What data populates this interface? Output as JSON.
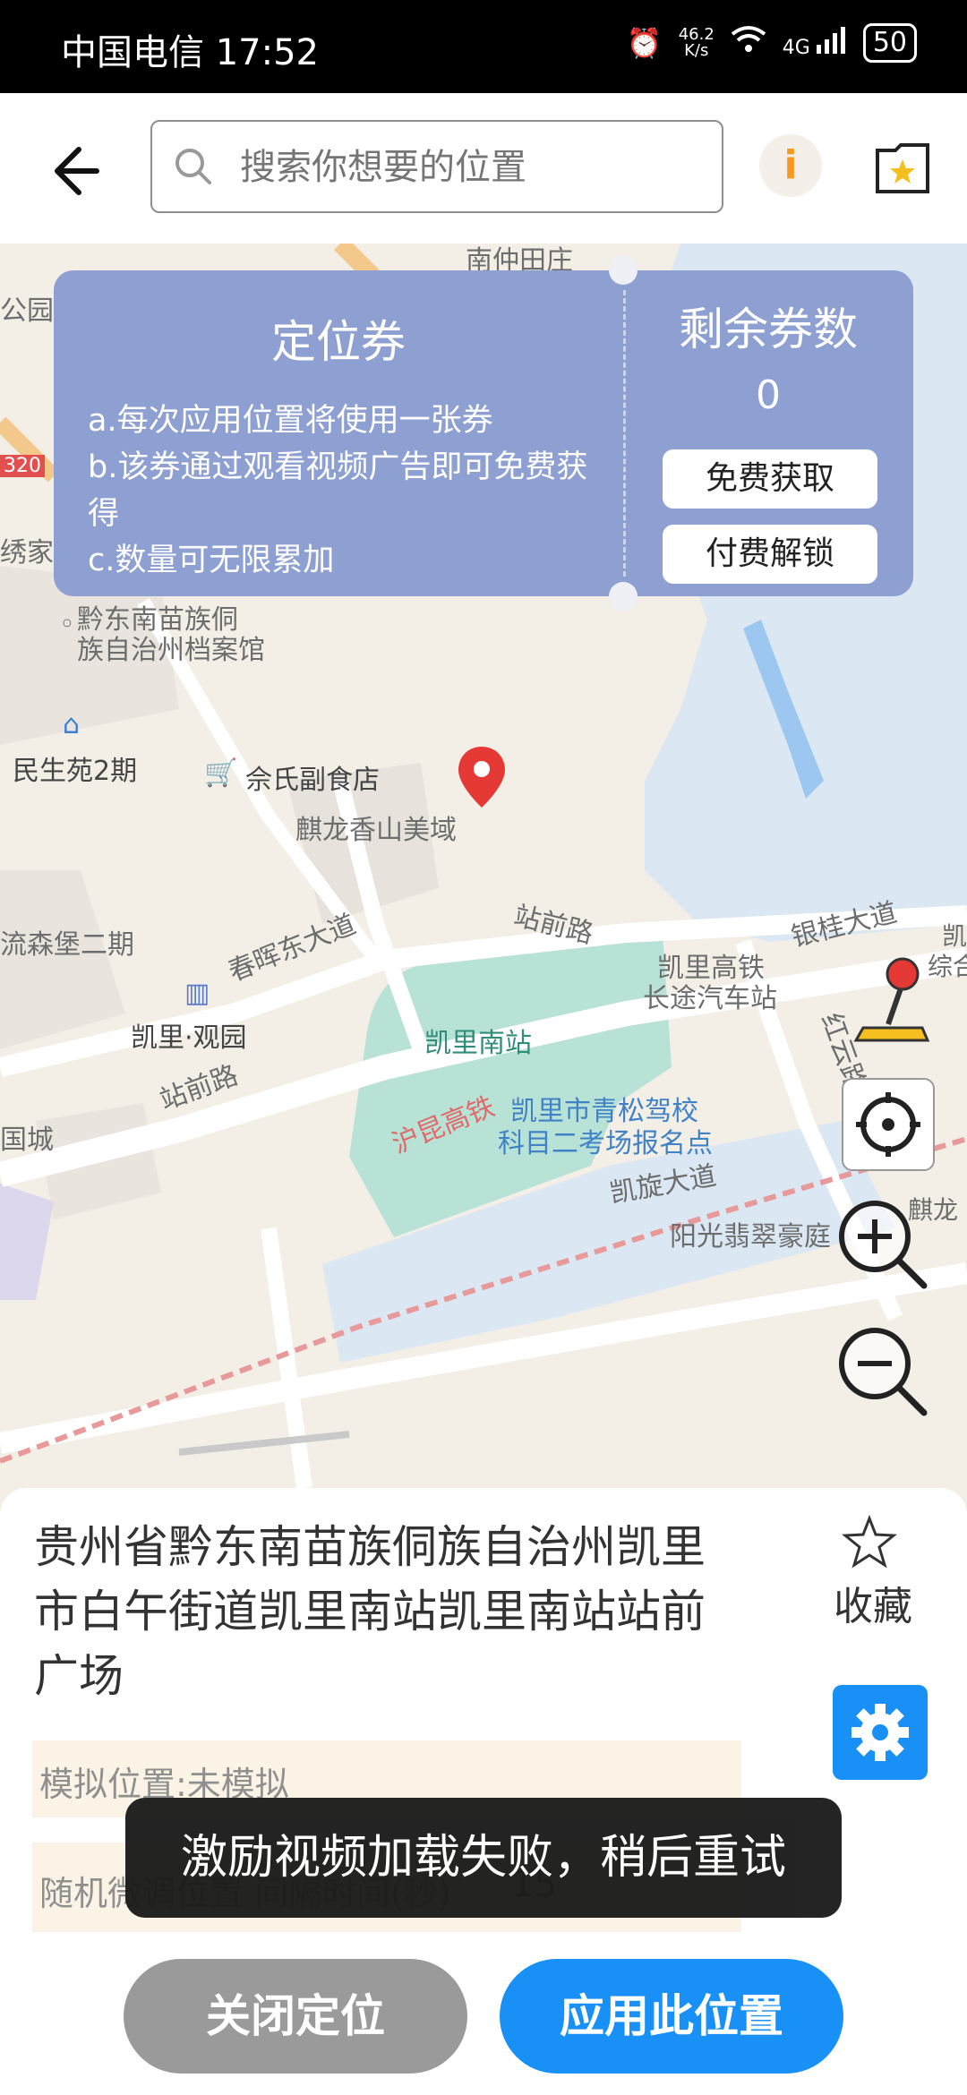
{
  "status_bar": {
    "carrier_time": "中国电信 17:52",
    "net_speed_top": "46.2",
    "net_speed_unit": "K/s",
    "network": "4G",
    "battery": "50"
  },
  "top_bar": {
    "search_placeholder": "搜索你想要的位置",
    "info_label": "i"
  },
  "coupon": {
    "title": "定位券",
    "rules": [
      "a.每次应用位置将使用一张券",
      "b.该券通过观看视频广告即可免费获得",
      "c.数量可无限累加"
    ],
    "remaining_label": "剩余券数",
    "remaining_count": "0",
    "free_button": "免费获取",
    "paid_button": "付费解锁"
  },
  "map": {
    "labels": {
      "archive": "黔东南苗族侗族自治州档案馆",
      "archive_line1": "黔东南苗族侗",
      "archive_line2": "族自治州档案馆",
      "minsheng": "民生苑2期",
      "yushi": "佘氏副食店",
      "qilong": "麒龙香山美域",
      "chunhui": "春晖东大道",
      "zhanqian_top": "站前路",
      "yingui": "银桂大道",
      "kaili_bus_1": "凯里高铁",
      "kaili_bus_2": "长途汽车站",
      "kaili_south": "凯里南站",
      "kaili_guanyuan": "凯里·观园",
      "zhanqian_bottom": "站前路",
      "hukun": "沪昆高铁",
      "driving_school_1": "凯里市青松驾校",
      "driving_school_2": "科目二考场报名点",
      "kaixuan": "凯旋大道",
      "hongyun": "红云路",
      "yangguang": "阳光翡翠豪庭",
      "liusen": "流森堡二期",
      "guocheng": "国城",
      "xiujia": "绣家",
      "gongyuan": "公园",
      "road_badge": "320",
      "top_edge": "南仲田庄",
      "right_edge_1": "凯",
      "right_edge_2": "综合",
      "right_edge_3": "麒龙"
    }
  },
  "panel": {
    "address": "贵州省黔东南苗族侗族自治州凯里市白午街道凯里南站凯里南站站前广场",
    "favorite_label": "收藏",
    "sim_status": "模拟位置:未模拟",
    "random_label": "随机微调位置 间隔时间(秒)",
    "random_value": "15",
    "toast": "激励视频加载失败，稍后重试",
    "close_button": "关闭定位",
    "apply_button": "应用此位置"
  }
}
